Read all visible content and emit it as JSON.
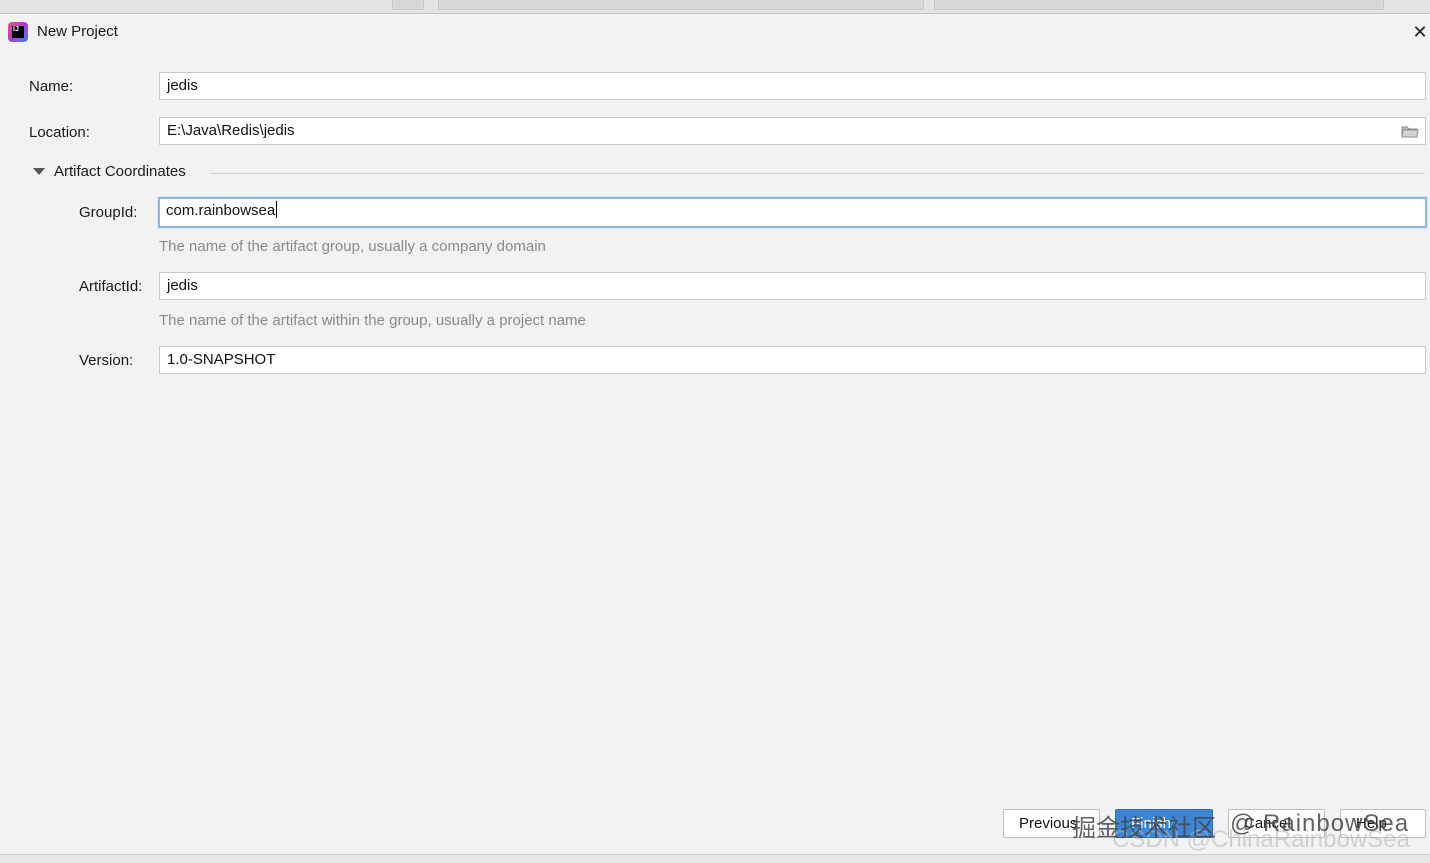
{
  "window": {
    "title": "New Project",
    "close_glyph": "✕",
    "app_icon": "intellij-icon",
    "app_icon_text": "IJ"
  },
  "form": {
    "name": {
      "label": "Name:",
      "value": "jedis"
    },
    "location": {
      "label": "Location:",
      "value": "E:\\Java\\Redis\\jedis",
      "icon": "folder-icon"
    }
  },
  "artifact": {
    "section_title": "Artifact Coordinates",
    "groupId": {
      "label": "GroupId:",
      "value": "com.rainbowsea",
      "hint": "The name of the artifact group, usually a company domain"
    },
    "artifactId": {
      "label": "ArtifactId:",
      "value": "jedis",
      "hint": "The name of the artifact within the group, usually a project name"
    },
    "version": {
      "label": "Version:",
      "value": "1.0-SNAPSHOT"
    }
  },
  "buttons": {
    "previous": "Previous",
    "finish": "Finish",
    "cancel": "Cancel",
    "help": "Help"
  },
  "watermark": {
    "lead": "掘金技术社区",
    "author": "@ RainbowSea",
    "ghost": "CSDN @ChinaRainbowSea"
  },
  "colors": {
    "accent": "#3b86d6",
    "focus_border": "#8fb7e6",
    "hint_text": "#8a8a8a"
  }
}
